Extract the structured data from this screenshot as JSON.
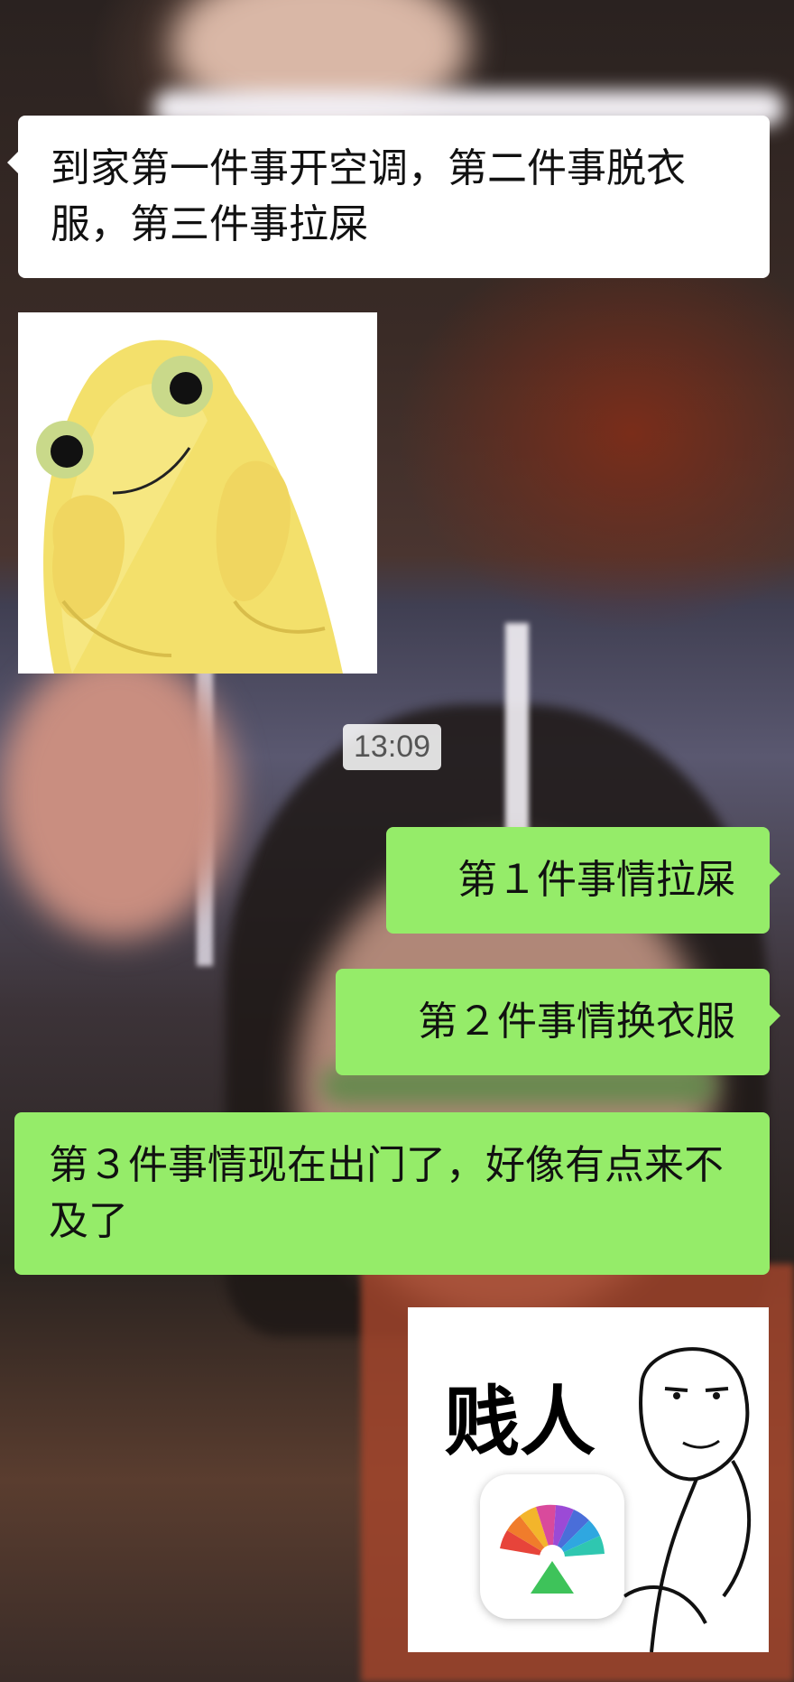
{
  "messages": [
    {
      "side": "left",
      "text": "到家第一件事开空调，第二件事脱衣服，第三件事拉屎"
    },
    {
      "side": "right",
      "text": "第１件事情拉屎"
    },
    {
      "side": "right",
      "text": "第２件事情换衣服"
    },
    {
      "side": "right",
      "text": "第３件事情现在出门了，好像有点来不及了"
    }
  ],
  "timestamp": "13:09",
  "stickers": {
    "yellow_blob": {
      "icon": "yellow-blob-sticker"
    },
    "meme": {
      "text": "贱人",
      "icon": "meme-face-sticker"
    }
  },
  "colors": {
    "bubble_left": "#ffffff",
    "bubble_right": "#95ec69"
  }
}
